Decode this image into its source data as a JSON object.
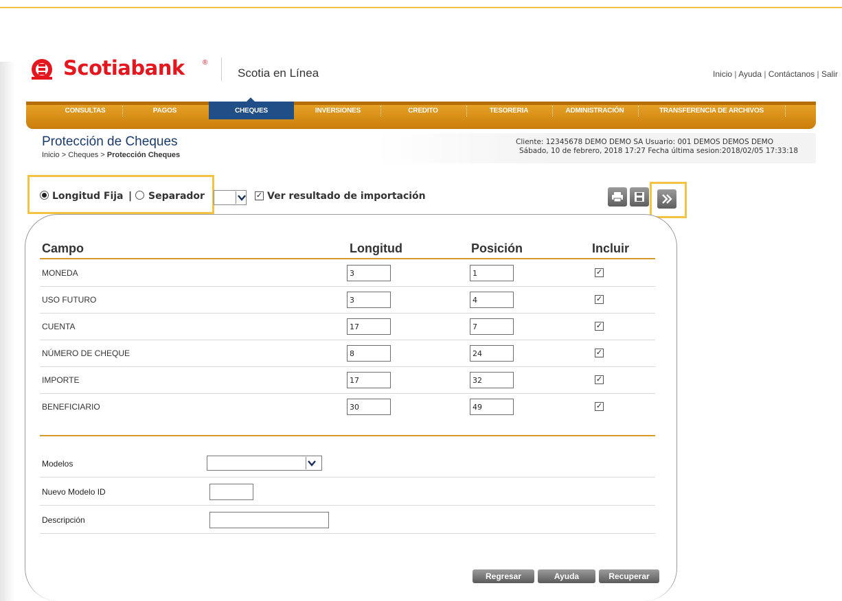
{
  "brand": {
    "name": "Scotiabank",
    "reg": "®",
    "app_name": "Scotia en Línea",
    "color": "#e4171f"
  },
  "top_links": {
    "inicio": "Inicio",
    "ayuda": "Ayuda",
    "contacto": "Contáctanos",
    "salir": "Salir",
    "separator": " | "
  },
  "nav": {
    "items": [
      "CONSULTAS",
      "PAGOS",
      "CHEQUES",
      "INVERSIONES",
      "CREDITO",
      "TESORERIA",
      "ADMINISTRACIÓN",
      "TRANSFERENCIA DE ARCHIVOS"
    ],
    "active": "CHEQUES",
    "bar_color": "#e0961e",
    "active_color": "#1f4f86"
  },
  "page": {
    "title": "Protección de Cheques",
    "breadcrumb_prefix": "Inicio > Cheques > ",
    "breadcrumb_current": "Protección Cheques"
  },
  "session": {
    "line1": "Cliente: 12345678 DEMO DEMO SA    Usuario: 001 DEMOS DEMOS DEMO",
    "line2": "Sábado, 10 de febrero, 2018 17:27    Fecha última sesion:2018/02/05 17:33:18"
  },
  "options": {
    "longitud_fija": "Longitud Fija",
    "pipe": "|",
    "separador": "Separador",
    "ver_resultado": "Ver resultado de importación",
    "selected_mode": "Longitud Fija",
    "ver_resultado_checked": true
  },
  "toolbar": {
    "icons": [
      "print-icon",
      "save-icon",
      "next-icon"
    ]
  },
  "table": {
    "headers": {
      "campo": "Campo",
      "longitud": "Longitud",
      "posicion": "Posición",
      "incluir": "Incluir"
    },
    "rows": [
      {
        "campo": "MONEDA",
        "longitud": "3",
        "posicion": "1",
        "incluir": true
      },
      {
        "campo": "USO FUTURO",
        "longitud": "3",
        "posicion": "4",
        "incluir": true
      },
      {
        "campo": "CUENTA",
        "longitud": "17",
        "posicion": "7",
        "incluir": true
      },
      {
        "campo": "NÚMERO DE CHEQUE",
        "longitud": "8",
        "posicion": "24",
        "incluir": true
      },
      {
        "campo": "IMPORTE",
        "longitud": "17",
        "posicion": "32",
        "incluir": true
      },
      {
        "campo": "BENEFICIARIO",
        "longitud": "30",
        "posicion": "49",
        "incluir": true
      }
    ]
  },
  "form": {
    "modelos_label": "Modelos",
    "modelos_value": "",
    "nuevo_modelo_label": "Nuevo Modelo   ID",
    "nuevo_modelo_value": "",
    "descripcion_label": "Descripción",
    "descripcion_value": ""
  },
  "buttons": {
    "regresar": "Regresar",
    "ayuda": "Ayuda",
    "recuperar": "Recuperar"
  },
  "colors": {
    "highlight": "#f5c342",
    "rule": "#d79a2a",
    "title": "#1a3a6e"
  }
}
